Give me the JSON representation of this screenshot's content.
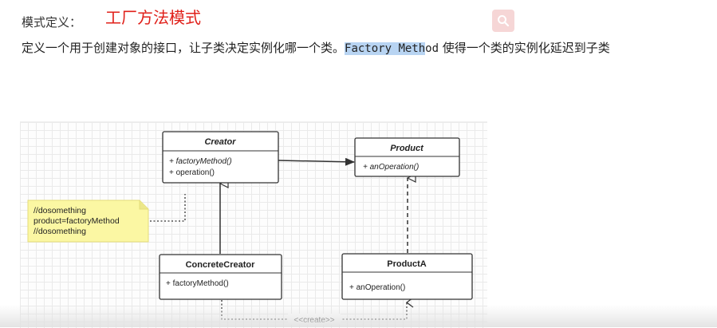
{
  "heading": {
    "label": "模式定义：",
    "title": "工厂方法模式"
  },
  "definition": {
    "part1": "定义一个用于创建对象的接口，让子类决定实例化哪一个类。",
    "code_highlight": "Factory Meth",
    "code_rest": "od",
    "part2": " 使得一个类的实例化延迟到子类"
  },
  "toolbar": {
    "icon": "search-icon",
    "accent": "#f6d6d6"
  },
  "diagram": {
    "creator": {
      "name": "Creator",
      "methods": [
        "+  factoryMethod()",
        "+ operation()"
      ]
    },
    "product": {
      "name": "Product",
      "methods": [
        "+ anOperation()"
      ]
    },
    "concrete_creator": {
      "name": "ConcreteCreator",
      "methods": [
        "+ factoryMethod()"
      ]
    },
    "product_a": {
      "name": "ProductA",
      "methods": [
        "+ anOperation()"
      ]
    },
    "note": {
      "lines": [
        "//dosomething",
        "product=factoryMethod",
        "//dosomething"
      ],
      "color": "#fbf7a3"
    },
    "create_label": "<<create>>"
  },
  "colors": {
    "title_red": "#e0201a",
    "highlight": "#b8d4f2",
    "note_yellow": "#fbf7a3"
  }
}
